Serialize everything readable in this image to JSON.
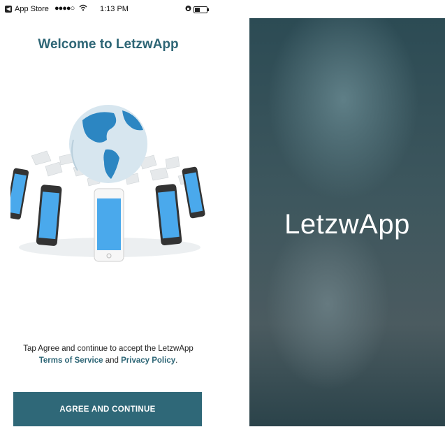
{
  "status_bar": {
    "back_badge": "◀",
    "back_app": "App Store",
    "signal": "●●●●○",
    "wifi": "wifi",
    "time": "1:13 PM",
    "lock": "lock",
    "battery": "battery"
  },
  "welcome": {
    "title": "Welcome to LetzwApp",
    "terms_line": "Tap Agree and continue to accept the LetzwApp",
    "terms_link": "Terms of Service",
    "and_text": " and ",
    "privacy_link": "Privacy Policy",
    "period": ".",
    "agree_button": "AGREE AND CONTINUE"
  },
  "splash": {
    "app_name": "LetzwApp"
  },
  "colors": {
    "accent": "#2e6676",
    "button_bg": "#2f6878",
    "splash_bg": "#3a545b"
  }
}
